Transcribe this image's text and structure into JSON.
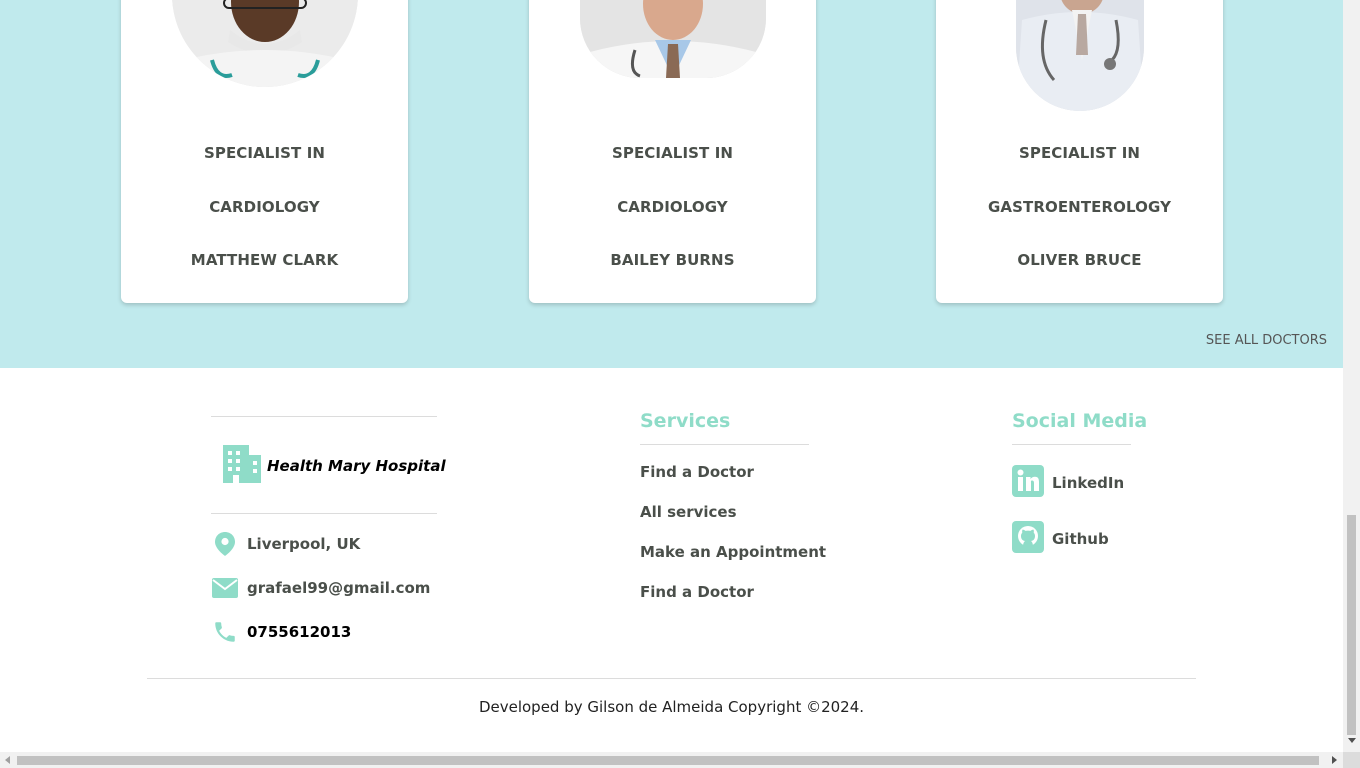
{
  "doctors": [
    {
      "specialty_prefix": "SPECIALIST IN",
      "specialty": "CARDIOLOGY",
      "name": "MATTHEW CLARK"
    },
    {
      "specialty_prefix": "SPECIALIST IN",
      "specialty": "CARDIOLOGY",
      "name": "BAILEY BURNS"
    },
    {
      "specialty_prefix": "SPECIALIST IN",
      "specialty": "GASTROENTEROLOGY",
      "name": "OLIVER BRUCE"
    }
  ],
  "see_all_label": "SEE ALL DOCTORS",
  "footer": {
    "brand": {
      "name": "Health Mary Hospital",
      "icon": "hospital-building-icon"
    },
    "contact": {
      "location": "Liverpool, UK",
      "email": "grafael99@gmail.com",
      "phone": "0755612013"
    },
    "services": {
      "title": "Services",
      "links": [
        "Find a Doctor",
        "All services",
        "Make an Appointment",
        "Find a Doctor"
      ]
    },
    "social": {
      "title": "Social Media",
      "links": [
        {
          "label": "LinkedIn",
          "icon": "linkedin-icon"
        },
        {
          "label": "Github",
          "icon": "github-icon"
        }
      ]
    },
    "copyright": "Developed by Gilson de Almeida Copyright ©2024."
  },
  "colors": {
    "band": "#c0eaed",
    "accent": "#8fdcc8",
    "text": "#4a4f4a"
  }
}
